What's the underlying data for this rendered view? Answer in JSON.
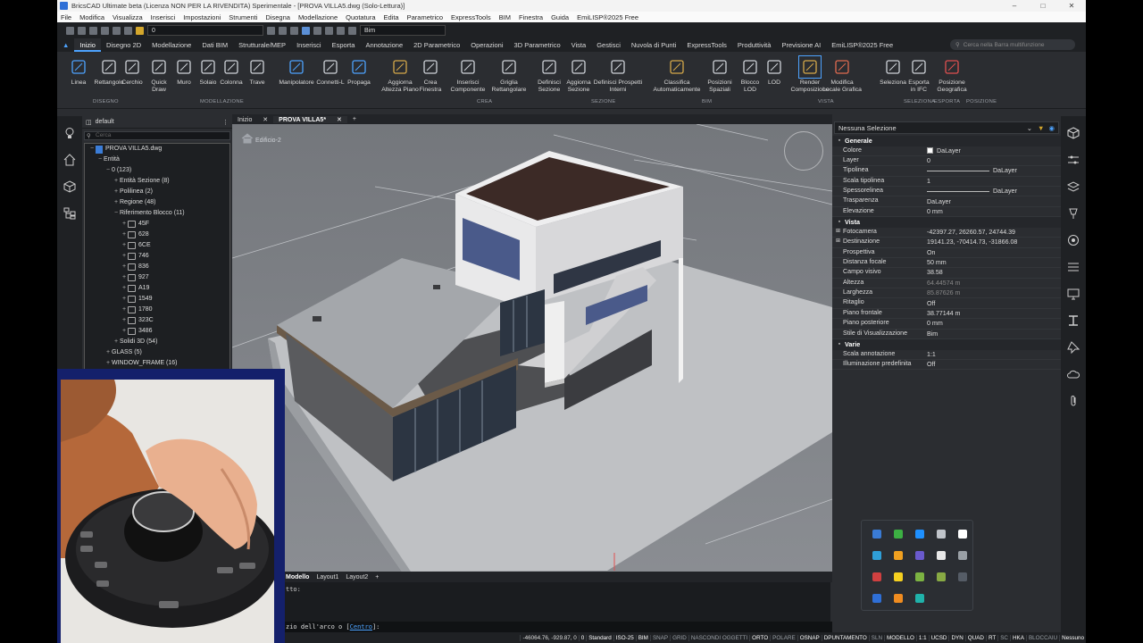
{
  "window": {
    "title": "BricsCAD Ultimate beta (Licenza NON PER LA RIVENDITA) Sperimentale - [PROVA VILLA5.dwg (Solo-Lettura)]"
  },
  "menu": [
    "File",
    "Modifica",
    "Visualizza",
    "Inserisci",
    "Impostazioni",
    "Strumenti",
    "Disegna",
    "Modellazione",
    "Quotatura",
    "Edita",
    "Parametrico",
    "ExpressTools",
    "BIM",
    "Finestra",
    "Guida",
    "EmiLISP®2025 Free"
  ],
  "qat": {
    "layer_value": "0",
    "workspace_value": "Bim"
  },
  "ribbon_tabs": [
    "Inizio",
    "Disegno 2D",
    "Modellazione",
    "Dati BIM",
    "Strutturale/MEP",
    "Inserisci",
    "Esporta",
    "Annotazione",
    "2D Parametrico",
    "Operazioni",
    "3D Parametrico",
    "Vista",
    "Gestisci",
    "Nuvola di Punti",
    "ExpressTools",
    "Produttività",
    "Previsione AI",
    "EmiLISP®2025 Free"
  ],
  "search_placeholder": "Cerca nella Barra multifunzione",
  "ribbon_buttons": [
    {
      "label": "Linea",
      "icon": "line-icon"
    },
    {
      "label": "Rettangolo",
      "icon": "rectangle-icon"
    },
    {
      "label": "Cerchio",
      "icon": "circle-icon"
    },
    {
      "label": "Quick Draw",
      "icon": "quickdraw-icon"
    },
    {
      "label": "Muro",
      "icon": "wall-icon"
    },
    {
      "label": "Solaio",
      "icon": "slab-icon"
    },
    {
      "label": "Colonna",
      "icon": "column-icon"
    },
    {
      "label": "Trave",
      "icon": "beam-icon"
    },
    {
      "label": "Manipolatore",
      "icon": "manipulator-icon"
    },
    {
      "label": "Connetti-L",
      "icon": "connect-l-icon"
    },
    {
      "label": "Propaga",
      "icon": "propagate-icon"
    },
    {
      "label": "Aggiorna Altezza Piano",
      "icon": "update-height-icon"
    },
    {
      "label": "Crea Finestra",
      "icon": "window-icon"
    },
    {
      "label": "Inserisci Componente",
      "icon": "component-icon"
    },
    {
      "label": "Griglia Rettangolare",
      "icon": "grid-icon"
    },
    {
      "label": "Definisci Sezione",
      "icon": "section-icon"
    },
    {
      "label": "Aggiorna Sezione",
      "icon": "update-section-icon"
    },
    {
      "label": "Definisci Prospetti Interni",
      "icon": "elevation-icon"
    },
    {
      "label": "Classifica Automaticamente",
      "icon": "classify-icon"
    },
    {
      "label": "Posizioni Spaziali",
      "icon": "spatial-icon"
    },
    {
      "label": "Blocco LOD",
      "icon": "lod-block-icon"
    },
    {
      "label": "LOD",
      "icon": "lod-icon"
    },
    {
      "label": "Render Composizione",
      "icon": "render-icon"
    },
    {
      "label": "Modifica Locale Grafica",
      "icon": "graphic-icon"
    },
    {
      "label": "Seleziona",
      "icon": "select-icon"
    },
    {
      "label": "Esporta in IFC",
      "icon": "ifc-icon"
    },
    {
      "label": "Posizione Geografica",
      "icon": "geo-icon"
    }
  ],
  "ribbon_groups": [
    "DISEGNO",
    "MODELLAZIONE",
    "CREA",
    "SEZIONE",
    "BIM",
    "VISTA",
    "SELEZIONA",
    "ESPORTA",
    "POSIZIONE"
  ],
  "browser": {
    "title": "default",
    "search_placeholder": "Cerca",
    "tree": [
      {
        "t": "PROVA VILLA5.dwg",
        "lvl": 0,
        "tog": "−",
        "kind": "dwg"
      },
      {
        "t": "Entità",
        "lvl": 1,
        "tog": "−"
      },
      {
        "t": "0 (123)",
        "lvl": 2,
        "tog": "−"
      },
      {
        "t": "Entità Sezione (8)",
        "lvl": 3,
        "tog": "+"
      },
      {
        "t": "Polilinea (2)",
        "lvl": 3,
        "tog": "+"
      },
      {
        "t": "Regione (48)",
        "lvl": 3,
        "tog": "+"
      },
      {
        "t": "Riferimento Blocco (11)",
        "lvl": 3,
        "tog": "−"
      },
      {
        "t": "45F",
        "lvl": 4,
        "tog": "+",
        "kind": "blk"
      },
      {
        "t": "628",
        "lvl": 4,
        "tog": "+",
        "kind": "blk"
      },
      {
        "t": "6CE",
        "lvl": 4,
        "tog": "+",
        "kind": "blk"
      },
      {
        "t": "746",
        "lvl": 4,
        "tog": "+",
        "kind": "blk"
      },
      {
        "t": "836",
        "lvl": 4,
        "tog": "+",
        "kind": "blk"
      },
      {
        "t": "927",
        "lvl": 4,
        "tog": "+",
        "kind": "blk"
      },
      {
        "t": "A19",
        "lvl": 4,
        "tog": "+",
        "kind": "blk"
      },
      {
        "t": "1549",
        "lvl": 4,
        "tog": "+",
        "kind": "blk"
      },
      {
        "t": "1780",
        "lvl": 4,
        "tog": "+",
        "kind": "blk"
      },
      {
        "t": "323C",
        "lvl": 4,
        "tog": "+",
        "kind": "blk"
      },
      {
        "t": "3486",
        "lvl": 4,
        "tog": "+",
        "kind": "blk"
      },
      {
        "t": "Solidi 3D (54)",
        "lvl": 3,
        "tog": "+"
      },
      {
        "t": "GLASS (5)",
        "lvl": 2,
        "tog": "+"
      },
      {
        "t": "WINDOW_FRAME (16)",
        "lvl": 2,
        "tog": "+"
      }
    ]
  },
  "doc_tabs": [
    {
      "label": "Inizio"
    },
    {
      "label": "PROVA VILLA5*"
    }
  ],
  "viewport": {
    "label": "Edificio-2"
  },
  "layout_tabs": [
    "Modello",
    "Layout1",
    "Layout2"
  ],
  "command": {
    "history": "tto:",
    "prompt": "zio dell'arco o [",
    "keyword": "Centro",
    "suffix": "]:"
  },
  "status": {
    "coords": "-46064.76, -929.87, 0",
    "items": [
      {
        "t": "0",
        "on": true
      },
      {
        "t": "Standard",
        "on": true
      },
      {
        "t": "ISO-25",
        "on": true
      },
      {
        "t": "BIM",
        "on": true
      },
      {
        "t": "SNAP",
        "on": false
      },
      {
        "t": "GRID",
        "on": false
      },
      {
        "t": "NASCONDI OGGETTI",
        "on": false
      },
      {
        "t": "ORTO",
        "on": true
      },
      {
        "t": "POLARE",
        "on": false
      },
      {
        "t": "OSNAP",
        "on": true
      },
      {
        "t": "DPUNTAMENTO",
        "on": true
      },
      {
        "t": "SLN",
        "on": false
      },
      {
        "t": "MODELLO",
        "on": true
      },
      {
        "t": "1:1",
        "on": true
      },
      {
        "t": "UCSD",
        "on": true
      },
      {
        "t": "DYN",
        "on": true
      },
      {
        "t": "QUAD",
        "on": true
      },
      {
        "t": "RT",
        "on": true
      },
      {
        "t": "SC",
        "on": false
      },
      {
        "t": "HKA",
        "on": true
      },
      {
        "t": "BLOCCAIU",
        "on": false
      },
      {
        "t": "Nessuno",
        "on": true
      }
    ]
  },
  "properties": {
    "selection": "Nessuna Selezione",
    "categories": [
      {
        "name": "Generale",
        "rows": [
          {
            "k": "Colore",
            "v": "DaLayer",
            "swatch": true
          },
          {
            "k": "Layer",
            "v": "0"
          },
          {
            "k": "Tipolinea",
            "v": "DaLayer",
            "line": true
          },
          {
            "k": "Scala tipolinea",
            "v": "1"
          },
          {
            "k": "Spessorelinea",
            "v": "DaLayer",
            "line": true
          },
          {
            "k": "Trasparenza",
            "v": "DaLayer"
          },
          {
            "k": "Elevazione",
            "v": "0 mm"
          }
        ]
      },
      {
        "name": "Vista",
        "rows": [
          {
            "k": "Fotocamera",
            "v": "-42397.27, 26260.57, 24744.39",
            "exp": true
          },
          {
            "k": "Destinazione",
            "v": "19141.23, -70414.73, -31866.08",
            "exp": true
          },
          {
            "k": "Prospettiva",
            "v": "On"
          },
          {
            "k": "Distanza focale",
            "v": "50 mm"
          },
          {
            "k": "Campo visivo",
            "v": "38.58"
          },
          {
            "k": "Altezza",
            "v": "64.44574 m",
            "dim": true
          },
          {
            "k": "Larghezza",
            "v": "85.87626 m",
            "dim": true
          },
          {
            "k": "Ritaglio",
            "v": "Off"
          },
          {
            "k": "Piano frontale",
            "v": "38.77144 m"
          },
          {
            "k": "Piano posteriore",
            "v": "0 mm"
          },
          {
            "k": "Stile di Visualizzazione",
            "v": "Bim"
          }
        ]
      },
      {
        "name": "Varie",
        "rows": [
          {
            "k": "Scala annotazione",
            "v": "1:1"
          },
          {
            "k": "Illuminazione predefinita",
            "v": "Off"
          }
        ]
      }
    ]
  },
  "tray_colors": [
    "#3a7bd5",
    "#3cb043",
    "#1e90ff",
    "#c0c4ca",
    "#ffffff",
    "#2f9fd8",
    "#f0a020",
    "#6a5acd",
    "#e8e8e8",
    "#9aa0a6",
    "#d04040",
    "#f5d020",
    "#7cb342",
    "#88aa44",
    "#555c66",
    "#2f6fd6",
    "#f08c20",
    "#20b2aa"
  ],
  "colors": {
    "accent": "#4da3ff",
    "viewport_bg": "#7a7d82",
    "panel": "#2b2d31"
  }
}
